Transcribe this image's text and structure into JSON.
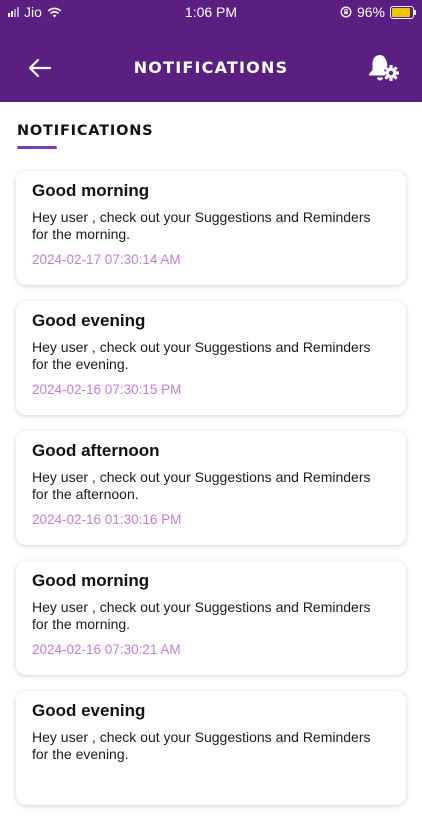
{
  "status_bar": {
    "carrier": "Jio",
    "time": "1:06 PM",
    "battery_percent": "96%"
  },
  "header": {
    "title": "NOTIFICATIONS"
  },
  "section": {
    "title": "NOTIFICATIONS"
  },
  "notifications": [
    {
      "title": "Good morning",
      "body": "Hey user , check out your Suggestions and Reminders for the morning.",
      "timestamp": "2024-02-17 07:30:14 AM"
    },
    {
      "title": "Good evening",
      "body": "Hey user , check out your Suggestions and Reminders for the evening.",
      "timestamp": "2024-02-16 07:30:15 PM"
    },
    {
      "title": "Good afternoon",
      "body": "Hey user , check out your Suggestions and Reminders for the afternoon.",
      "timestamp": "2024-02-16 01:30:16 PM"
    },
    {
      "title": "Good morning",
      "body": "Hey user , check out your Suggestions and Reminders for the morning.",
      "timestamp": "2024-02-16 07:30:21 AM"
    },
    {
      "title": "Good evening",
      "body": "Hey user , check out your Suggestions and Reminders for the evening.",
      "timestamp": ""
    }
  ],
  "colors": {
    "header_bg": "#5a1f80",
    "accent": "#7b3fb3",
    "timestamp": "#c67cd8",
    "battery": "#f2c400"
  },
  "icons": {
    "back": "arrow-left-icon",
    "settings": "bell-gear-icon",
    "wifi": "wifi-icon",
    "lock": "orientation-lock-icon",
    "battery": "battery-icon"
  }
}
